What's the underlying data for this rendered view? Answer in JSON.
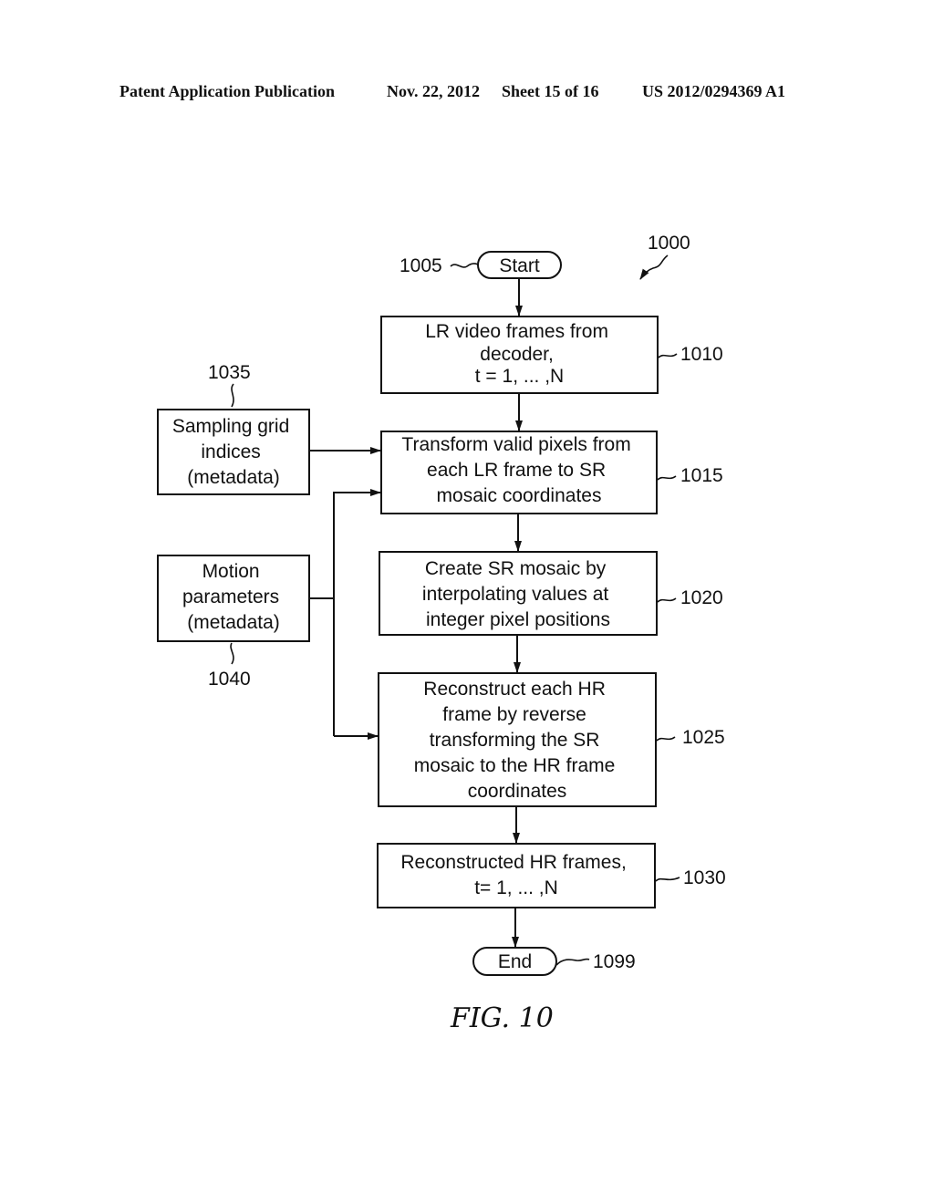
{
  "header": {
    "publication": "Patent Application Publication",
    "date": "Nov. 22, 2012",
    "sheet": "Sheet 15 of 16",
    "number": "US 2012/0294369 A1"
  },
  "diagram": {
    "figure_ref": "1000",
    "caption": "FIG. 10",
    "start": {
      "label": "Start",
      "ref": "1005"
    },
    "end": {
      "label": "End",
      "ref": "1099"
    },
    "steps": [
      {
        "ref": "1010",
        "lines": [
          "LR video frames from",
          "decoder,",
          "t = 1, ... ,N"
        ]
      },
      {
        "ref": "1015",
        "lines": [
          "Transform valid pixels from",
          "each LR frame to SR",
          "mosaic coordinates"
        ]
      },
      {
        "ref": "1020",
        "lines": [
          "Create SR mosaic by",
          "interpolating values at",
          "integer pixel positions"
        ]
      },
      {
        "ref": "1025",
        "lines": [
          "Reconstruct each HR",
          "frame by reverse",
          "transforming the SR",
          "mosaic to the HR frame",
          "coordinates"
        ]
      },
      {
        "ref": "1030",
        "lines": [
          "Reconstructed HR frames,",
          "t= 1, ... ,N"
        ]
      }
    ],
    "inputs": [
      {
        "ref": "1035",
        "lines": [
          "Sampling grid",
          "indices",
          "(metadata)"
        ]
      },
      {
        "ref": "1040",
        "lines": [
          "Motion",
          "parameters",
          "(metadata)"
        ]
      }
    ]
  }
}
